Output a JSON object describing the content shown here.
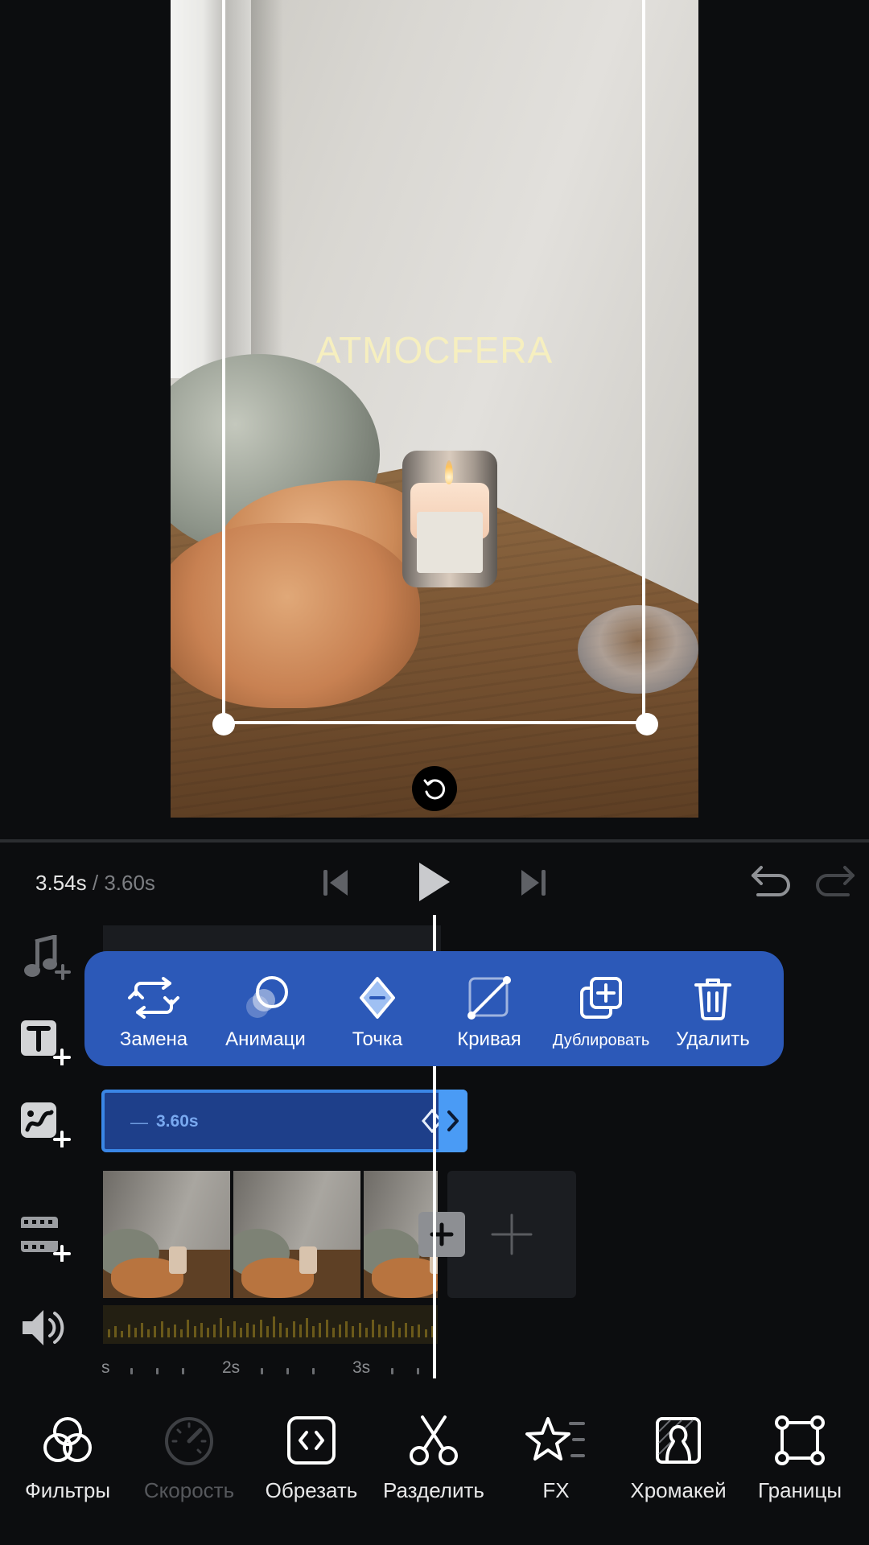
{
  "preview": {
    "overlay_text": "ATMOCFERA"
  },
  "transport": {
    "current_time": "3.54s",
    "separator": "/",
    "total_time": "3.60s"
  },
  "popup_toolbar": {
    "items": [
      {
        "label": "Замена",
        "icon": "replace-icon"
      },
      {
        "label": "Анимаци",
        "icon": "animation-icon"
      },
      {
        "label": "Точка",
        "icon": "keyframe-point-icon"
      },
      {
        "label": "Кривая",
        "icon": "curve-icon"
      },
      {
        "label": "Дублировать",
        "icon": "duplicate-icon"
      },
      {
        "label": "Удалить",
        "icon": "trash-icon"
      }
    ]
  },
  "timeline": {
    "clip_duration": "3.60s",
    "clip_dash": "—",
    "ruler": [
      "s",
      "2s",
      "3s"
    ]
  },
  "track_icons": [
    "add-music-icon",
    "add-text-icon",
    "add-sticker-icon",
    "add-video-icon",
    "volume-icon"
  ],
  "bottom_tools": {
    "items": [
      {
        "label": "Фильтры",
        "icon": "filters-icon",
        "enabled": true
      },
      {
        "label": "Скорость",
        "icon": "speed-icon",
        "enabled": false
      },
      {
        "label": "Обрезать",
        "icon": "trim-icon",
        "enabled": true
      },
      {
        "label": "Разделить",
        "icon": "split-scissors-icon",
        "enabled": true
      },
      {
        "label": "FX",
        "icon": "fx-star-icon",
        "enabled": true
      },
      {
        "label": "Хромакей",
        "icon": "chroma-key-icon",
        "enabled": true
      },
      {
        "label": "Границы",
        "icon": "borders-icon",
        "enabled": true
      }
    ]
  },
  "colors": {
    "background": "#0c0d0f",
    "popup": "#2c59b8",
    "clip": "#1e3f8a",
    "clip_border": "#3a86e6",
    "overlay_text": "#f6efbf"
  }
}
